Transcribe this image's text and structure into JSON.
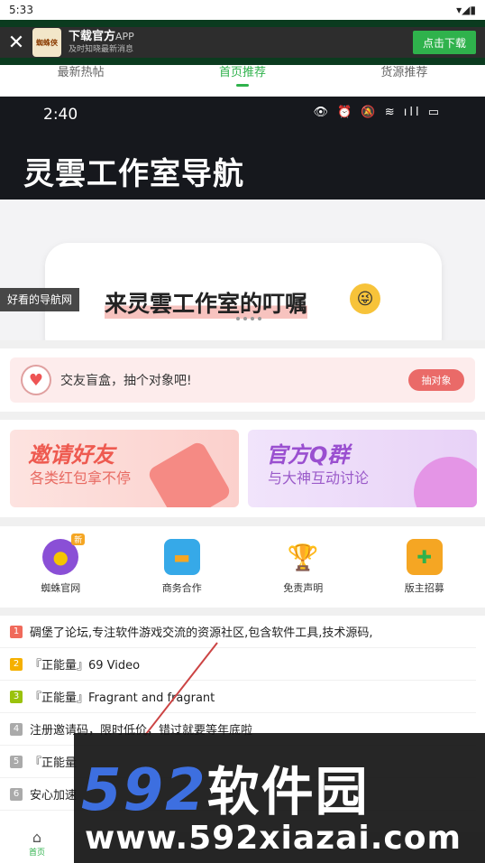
{
  "statusbar": {
    "time": "5:33",
    "icons": "▾◢▮"
  },
  "banner": {
    "logo_text": "蜘蛛侠",
    "title": "下载官方",
    "title_suffix": "APP",
    "subtitle": "及时知晓最新消息",
    "download_label": "点击下载"
  },
  "tabs": [
    {
      "label": "最新热帖"
    },
    {
      "label": "首页推荐"
    },
    {
      "label": "货源推荐"
    }
  ],
  "hero": {
    "time": "2:40",
    "heading": "灵雲工作室导航",
    "card_text": "来灵雲工作室的叮嘱",
    "caption": "好看的导航网"
  },
  "match": {
    "text": "交友盲盒，抽个对象吧!",
    "button": "抽对象"
  },
  "promos": [
    {
      "title": "邀请好友",
      "subtitle": "各类红包拿不停"
    },
    {
      "title": "官方Q群",
      "subtitle": "与大神互动讨论"
    }
  ],
  "quick_links": [
    {
      "label": "蜘蛛官网",
      "badge": "新",
      "icon": "pacman-icon"
    },
    {
      "label": "商务合作",
      "icon": "toolbox-icon"
    },
    {
      "label": "免责声明",
      "icon": "trophy-icon"
    },
    {
      "label": "版主招募",
      "icon": "gamepad-icon"
    }
  ],
  "list": [
    {
      "num": "1",
      "text": "碉堡了论坛,专注软件游戏交流的资源社区,包含软件工具,技术源码,",
      "color": "#f06a5b"
    },
    {
      "num": "2",
      "text": "『正能量』69 Video",
      "color": "#f5b000"
    },
    {
      "num": "3",
      "text": "『正能量』Fragrant and fragrant",
      "color": "#9ac20c"
    },
    {
      "num": "4",
      "text": "注册邀请码，限时低价，错过就要等年底啦",
      "color": "#aaaaaa"
    },
    {
      "num": "5",
      "text": "『正能量",
      "color": "#aaaaaa"
    },
    {
      "num": "6",
      "text": "安心加速",
      "color": "#aaaaaa"
    }
  ],
  "watermark": {
    "brand_num": "592",
    "brand_text": "软件园",
    "url": "www.592xiazai.com"
  },
  "bottomnav": {
    "home_label": "首页"
  }
}
